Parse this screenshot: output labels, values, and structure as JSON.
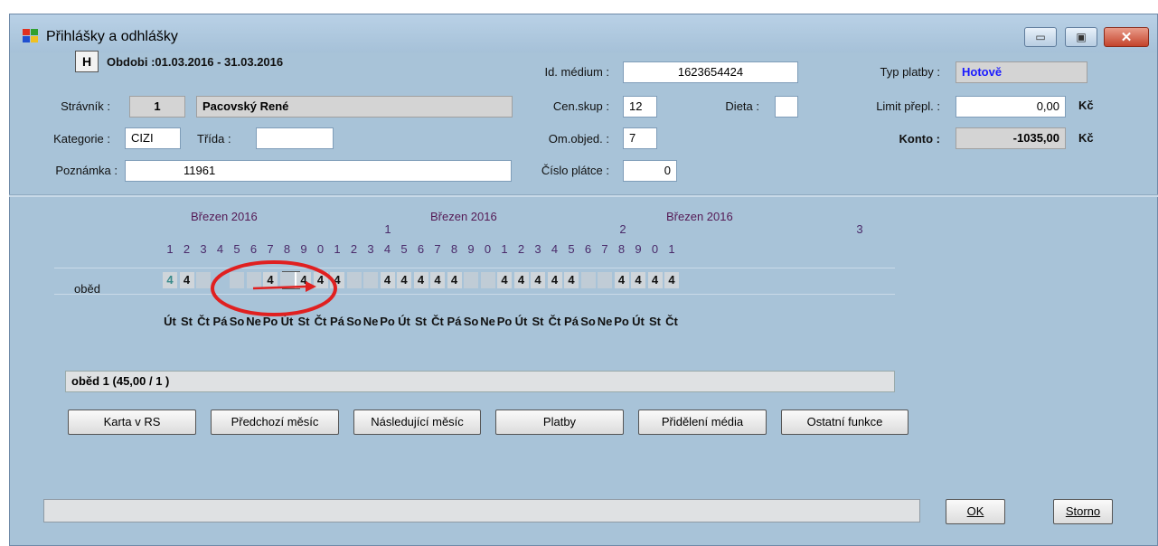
{
  "window": {
    "title": "Přihlášky a odhlášky",
    "min_label": "▭",
    "max_label": "▣",
    "close_label": "✕"
  },
  "header": {
    "h_button": "H",
    "period": "Obdobi :01.03.2016 - 31.03.2016",
    "stravnik_label": "Strávník :",
    "stravnik_number": "1",
    "stravnik_name": "Pacovský René",
    "kategorie_label": "Kategorie :",
    "kategorie_value": "CIZI",
    "trida_label": "Třída :",
    "trida_value": "",
    "poznamka_label": "Poznámka :",
    "poznamka_value": "11961",
    "id_medium_label": "Id. médium :",
    "id_medium_value": "1623654424",
    "censkup_label": "Cen.skup :",
    "censkup_value": "12",
    "dieta_label": "Dieta :",
    "dieta_value": "",
    "omobjed_label": "Om.objed. :",
    "omobjed_value": "7",
    "cislo_platce_label": "Číslo plátce :",
    "cislo_platce_value": "0",
    "typ_platby_label": "Typ platby :",
    "typ_platby_value": "Hotově",
    "limit_label": "Limit přepl. :",
    "limit_value": "0,00",
    "limit_unit": "Kč",
    "konto_label": "Konto :",
    "konto_value": "-1035,00",
    "konto_unit": "Kč"
  },
  "calendar": {
    "month_labels": [
      "Březen 2016",
      "Březen 2016",
      "Březen 2016"
    ],
    "tens_labels": [
      "1",
      "2",
      "3"
    ],
    "day_digits": [
      "1",
      "2",
      "3",
      "4",
      "5",
      "6",
      "7",
      "8",
      "9",
      "0",
      "1",
      "2",
      "3",
      "4",
      "5",
      "6",
      "7",
      "8",
      "9",
      "0",
      "1",
      "2",
      "3",
      "4",
      "5",
      "6",
      "7",
      "8",
      "9",
      "0",
      "1"
    ],
    "row_label": "oběd",
    "meal_values": [
      "4",
      "4",
      "",
      "4",
      "",
      "",
      "4",
      "",
      "4",
      "4",
      "4",
      "",
      "",
      "4",
      "4",
      "4",
      "4",
      "4",
      "",
      "",
      "4",
      "4",
      "4",
      "4",
      "4",
      "",
      "",
      "4",
      "4",
      "4",
      "4"
    ],
    "weekdays": [
      "Út",
      "St",
      "Čt",
      "Pá",
      "So",
      "Ne",
      "Po",
      "Út",
      "St",
      "Čt",
      "Pá",
      "So",
      "Ne",
      "Po",
      "Út",
      "St",
      "Čt",
      "Pá",
      "So",
      "Ne",
      "Po",
      "Út",
      "St",
      "Čt",
      "Pá",
      "So",
      "Ne",
      "Po",
      "Út",
      "St",
      "Čt"
    ]
  },
  "info": {
    "text": "oběd 1  (45,00 / 1 )"
  },
  "buttons": {
    "karta": "Karta v RS",
    "predchozi": "Předchozí měsíc",
    "nasledujici": "Následující měsíc",
    "platby": "Platby",
    "prideleni": "Přidělení média",
    "ostatni": "Ostatní funkce",
    "ok": "OK",
    "storno": "Storno"
  },
  "colors": {
    "window_bg": "#a8c3d8",
    "annotation": "#e02020",
    "link_blue": "#1a1aff"
  }
}
